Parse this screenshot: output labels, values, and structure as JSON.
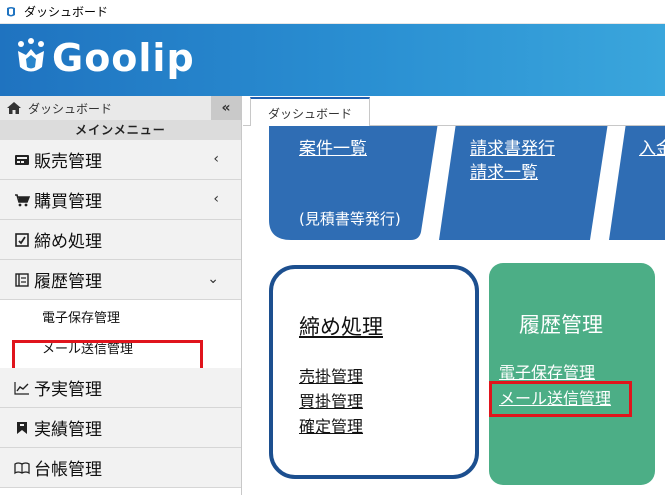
{
  "window": {
    "title": "ダッシュボード"
  },
  "brand": {
    "logo_text": "Goolip"
  },
  "sidebar": {
    "breadcrumb": "ダッシュボード",
    "collapse_label": "«",
    "menu_title": "メインメニュー",
    "items": [
      {
        "label": "販売管理",
        "icon": "register-icon",
        "arrow": "‹"
      },
      {
        "label": "購買管理",
        "icon": "cart-icon",
        "arrow": "‹"
      },
      {
        "label": "締め処理",
        "icon": "checkbox-icon",
        "arrow": ""
      },
      {
        "label": "履歴管理",
        "icon": "ledger-icon",
        "arrow": "⌄"
      }
    ],
    "subitems": [
      {
        "label": "電子保存管理"
      },
      {
        "label": "メール送信管理",
        "highlighted": true
      }
    ],
    "items_after": [
      {
        "label": "予実管理",
        "icon": "chart-icon"
      },
      {
        "label": "実績管理",
        "icon": "bookmark-icon"
      },
      {
        "label": "台帳管理",
        "icon": "book-icon"
      }
    ]
  },
  "tabs": [
    {
      "label": "ダッシュボード",
      "active": true
    }
  ],
  "main": {
    "top_links": {
      "anken": "案件一覧",
      "anken_note": "(見積書等発行)",
      "seikyu_1": "請求書発行",
      "seikyu_2": "請求一覧",
      "nyukin_partial": "入金"
    },
    "shime_card": {
      "title": "締め処理",
      "links": [
        "売掛管理",
        "買掛管理",
        "確定管理"
      ]
    },
    "rireki_card": {
      "title": "履歴管理",
      "links": [
        "電子保存管理",
        "メール送信管理"
      ],
      "highlighted_link": "メール送信管理"
    }
  },
  "colors": {
    "header_blue": "#1f73c0",
    "nav_blue_tile": "#2f6db4",
    "navy_border": "#1c4f8f",
    "green_card": "#4cae86",
    "highlight_red": "#e0141c"
  }
}
